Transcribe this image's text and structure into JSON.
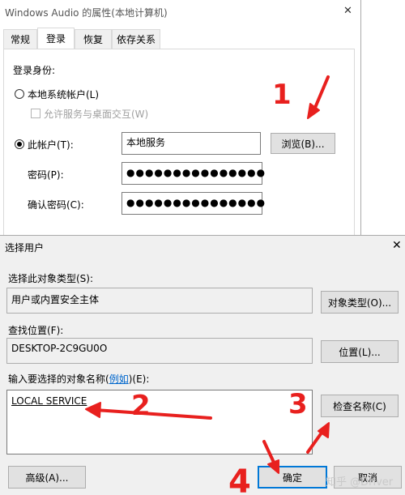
{
  "properties_dialog": {
    "title": "Windows Audio 的属性(本地计算机)",
    "close_glyph": "✕",
    "tabs": [
      {
        "label": "常规"
      },
      {
        "label": "登录"
      },
      {
        "label": "恢复"
      },
      {
        "label": "依存关系"
      }
    ],
    "active_tab": "登录",
    "logon_as_label": "登录身份:",
    "local_system_label": "本地系统帐户(L)",
    "allow_desktop_label": "允许服务与桌面交互(W)",
    "this_account_label": "此帐户(T):",
    "account_value": "本地服务",
    "browse_button": "浏览(B)...",
    "password_label": "密码(P):",
    "password_value": "●●●●●●●●●●●●●●●",
    "confirm_password_label": "确认密码(C):",
    "confirm_password_value": "●●●●●●●●●●●●●●●"
  },
  "select_user_dialog": {
    "title": "选择用户",
    "close_glyph": "✕",
    "object_type_label": "选择此对象类型(S):",
    "object_type_value": "用户或内置安全主体",
    "object_types_button": "对象类型(O)...",
    "location_label": "查找位置(F):",
    "location_value": "DESKTOP-2C9GU0O",
    "locations_button": "位置(L)...",
    "enter_names_label_prefix": "输入要选择的对象名称(",
    "enter_names_link": "例如",
    "enter_names_label_suffix": ")(E):",
    "names_value": "LOCAL SERVICE",
    "check_names_button": "检查名称(C)",
    "advanced_button": "高级(A)...",
    "ok_button": "确定",
    "cancel_button": "取消"
  },
  "annotations": {
    "numbers": [
      "1",
      "2",
      "3",
      "4"
    ],
    "color": "#e8201e"
  },
  "watermark": "知乎 @Driver"
}
